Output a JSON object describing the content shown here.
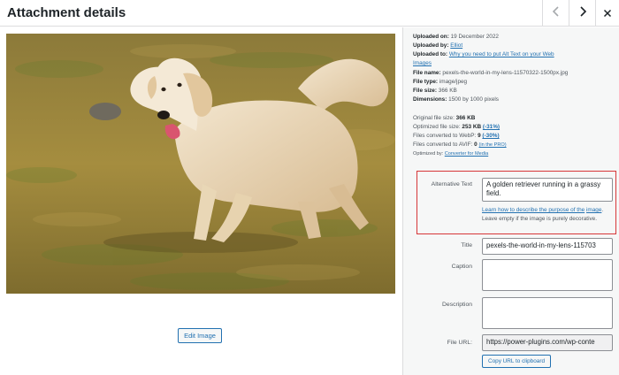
{
  "modal": {
    "title": "Attachment details",
    "prev_icon": "chevron-left-icon",
    "next_icon": "chevron-right-icon",
    "close_icon": "close-icon"
  },
  "image": {
    "edit_label": "Edit Image"
  },
  "details": {
    "uploaded_on_label": "Uploaded on:",
    "uploaded_on": "19 December 2022",
    "uploaded_by_label": "Uploaded by:",
    "uploaded_by": "Elliot",
    "uploaded_to_label": "Uploaded to:",
    "uploaded_to_line1": "Why you need to put Alt Text on your Web",
    "uploaded_to_line2": "Images",
    "file_name_label": "File name:",
    "file_name": "pexels-the-world-in-my-lens-11570322-1500px.jpg",
    "file_type_label": "File type:",
    "file_type": "image/jpeg",
    "file_size_label": "File size:",
    "file_size": "366 KB",
    "dimensions_label": "Dimensions:",
    "dimensions": "1500 by 1000 pixels"
  },
  "optimization": {
    "original_label": "Original file size:",
    "original": "366 KB",
    "optimized_label": "Optimized file size:",
    "optimized": "253 KB",
    "optimized_pct": "(-31%)",
    "webp_label": "Files converted to WebP:",
    "webp": "9",
    "webp_pct": "(-30%)",
    "avif_label": "Files converted to AVIF:",
    "avif": "0",
    "avif_note": "(in the PRO)",
    "optimized_by_label": "Optimized by:",
    "optimized_by": "Converter for Media"
  },
  "fields": {
    "alt_label": "Alternative Text",
    "alt_value": "A golden retriever running in a grassy field.",
    "alt_help_link_1": "Learn how to describe the purpose of the",
    "alt_help_link_2": "image",
    "alt_help_rest": ". Leave empty if the image is purely decorative.",
    "title_label": "Title",
    "title_value": "pexels-the-world-in-my-lens-115703",
    "caption_label": "Caption",
    "caption_value": "",
    "description_label": "Description",
    "description_value": "",
    "file_url_label": "File URL:",
    "file_url_value": "https://power-plugins.com/wp-conte",
    "copy_url_label": "Copy URL to clipboard"
  },
  "colors": {
    "accent": "#2271b1",
    "highlight_border": "#d63638",
    "sidebar_bg": "#f6f7f7"
  }
}
